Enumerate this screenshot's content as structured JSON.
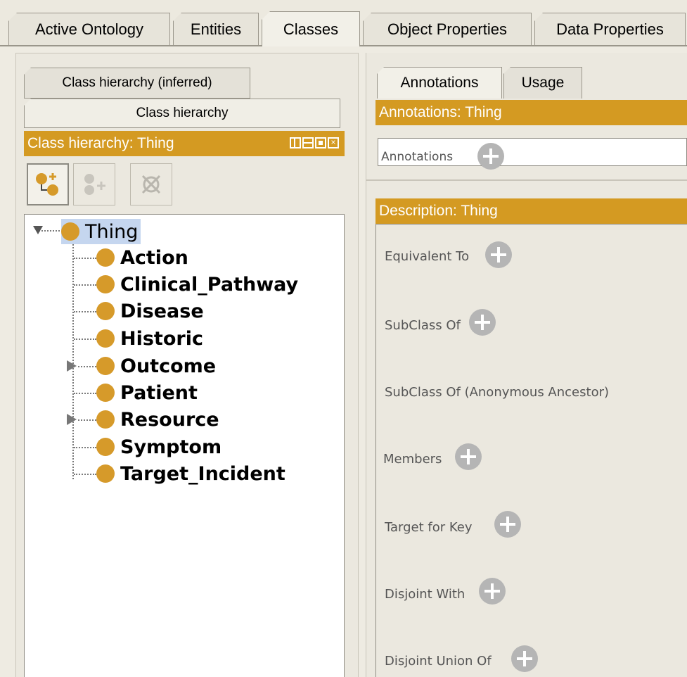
{
  "top_tabs": [
    {
      "label": "Active Ontology"
    },
    {
      "label": "Entities"
    },
    {
      "label": "Classes",
      "active": true
    },
    {
      "label": "Object Properties"
    },
    {
      "label": "Data Properties"
    }
  ],
  "left": {
    "subtabs": [
      "Class hierarchy (inferred)",
      "Class hierarchy"
    ],
    "header": "Class hierarchy: Thing",
    "toolbar_icons": [
      "add-subclass-icon",
      "add-sibling-class-icon",
      "delete-class-icon"
    ],
    "tree": {
      "root": "Thing",
      "children": [
        {
          "label": "Action"
        },
        {
          "label": "Clinical_Pathway"
        },
        {
          "label": "Disease"
        },
        {
          "label": "Historic"
        },
        {
          "label": "Outcome",
          "collapsed": true
        },
        {
          "label": "Patient"
        },
        {
          "label": "Resource",
          "collapsed": true
        },
        {
          "label": "Symptom"
        },
        {
          "label": "Target_Incident"
        }
      ]
    }
  },
  "right": {
    "tabs": [
      "Annotations",
      "Usage"
    ],
    "annotations_header": "Annotations: Thing",
    "annotations_label": "Annotations",
    "description_header": "Description: Thing",
    "sections": [
      "Equivalent To",
      "SubClass Of",
      "SubClass Of (Anonymous Ancestor)",
      "Members",
      "Target for Key",
      "Disjoint With",
      "Disjoint Union Of"
    ]
  },
  "colors": {
    "header_bar": "#d49a22",
    "class_bullet": "#d69a2a",
    "selection": "#c5d6ef"
  }
}
